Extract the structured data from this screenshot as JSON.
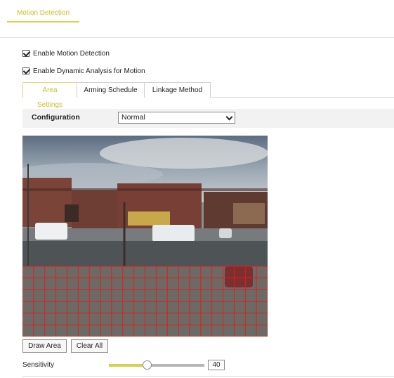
{
  "header": {
    "tab_label": "Motion Detection",
    "accent_color": "#d8d24b"
  },
  "options": {
    "enable_motion_detection": {
      "label": "Enable Motion Detection",
      "checked": true
    },
    "enable_dynamic_analysis": {
      "label": "Enable Dynamic Analysis for Motion",
      "checked": true
    }
  },
  "subtabs": [
    {
      "label": "Area Settings",
      "active": true
    },
    {
      "label": "Arming Schedule",
      "active": false
    },
    {
      "label": "Linkage Method",
      "active": false
    }
  ],
  "configuration": {
    "label": "Configuration",
    "value": "Normal"
  },
  "video": {
    "grid_color": "#e41b1b"
  },
  "buttons": {
    "draw_area": "Draw Area",
    "clear_all": "Clear All"
  },
  "sensitivity": {
    "label": "Sensitivity",
    "value": "40",
    "level_percent": 40
  }
}
